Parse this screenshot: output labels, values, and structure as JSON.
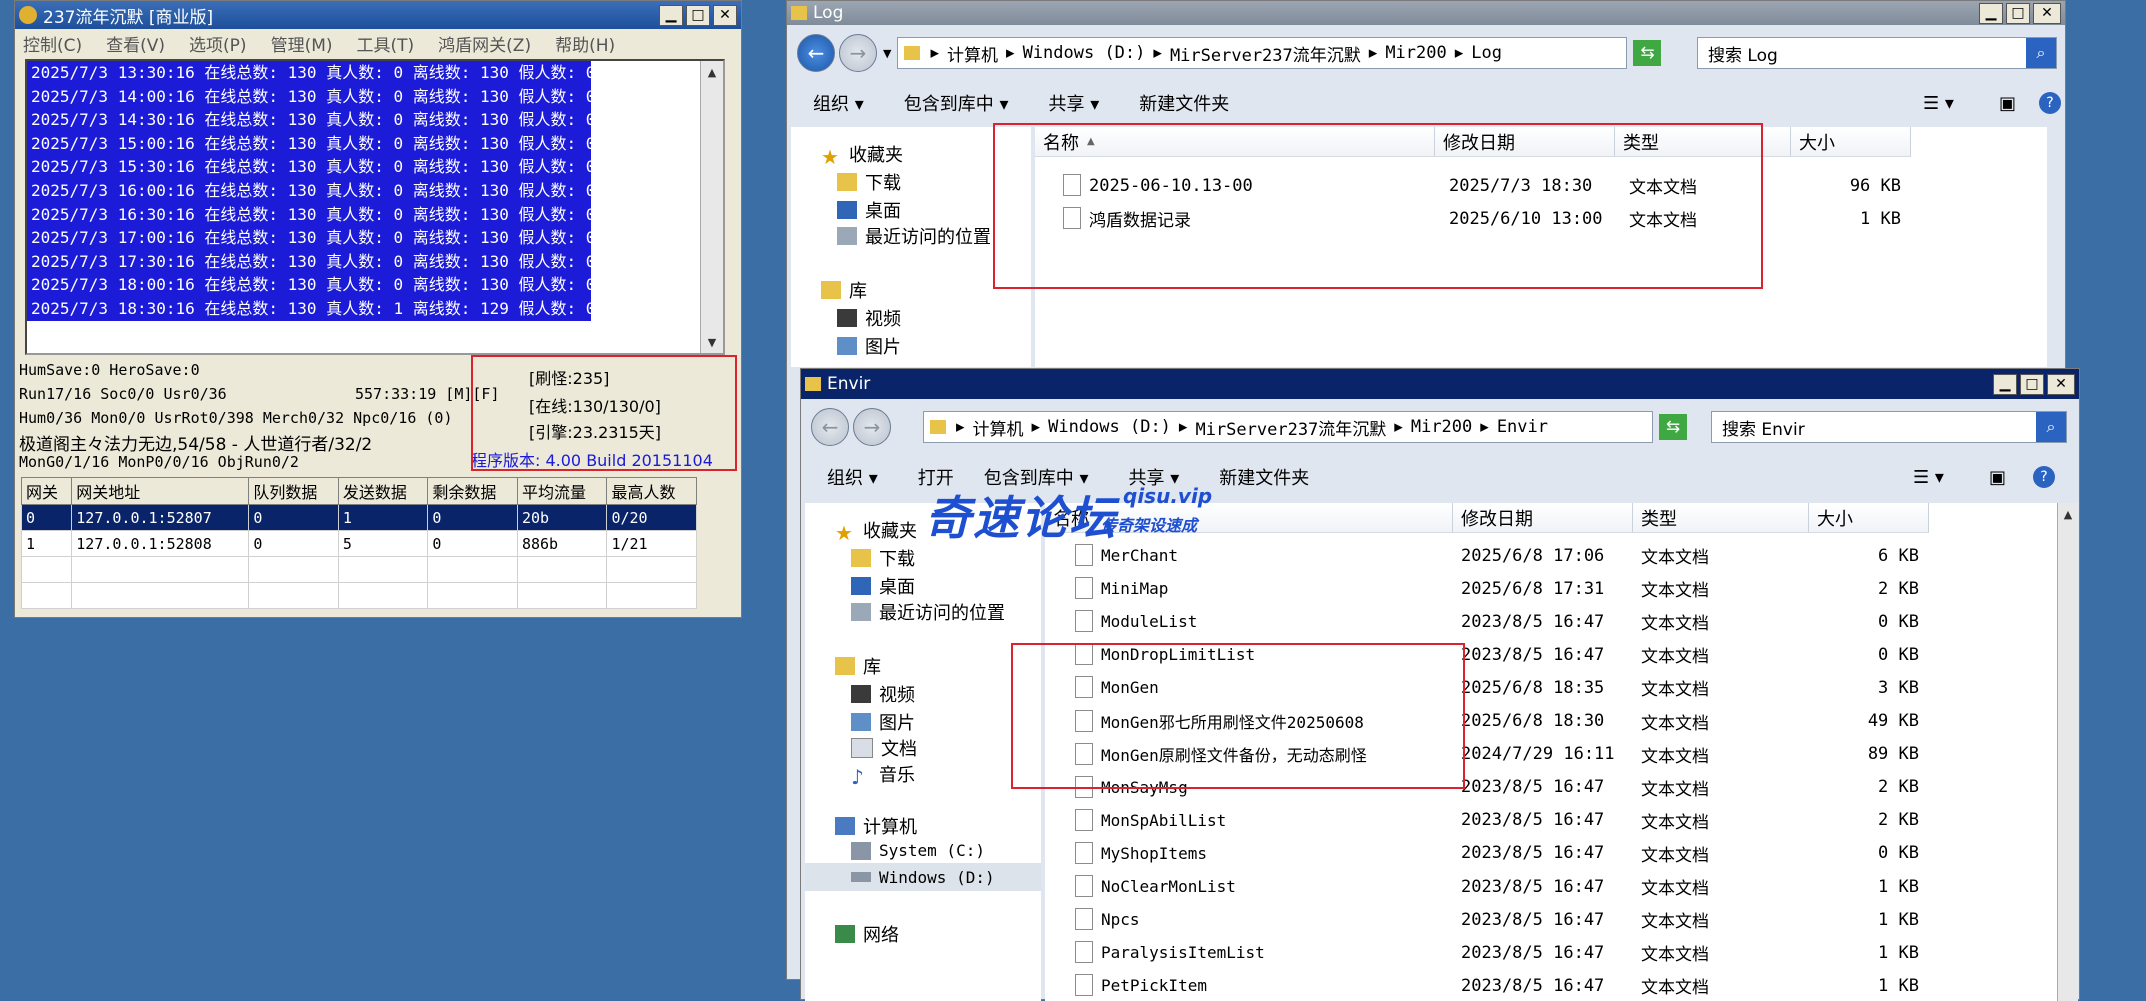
{
  "server": {
    "title": "237流年沉默 [商业版]",
    "menu": [
      "控制(C)",
      "查看(V)",
      "选项(P)",
      "管理(M)",
      "工具(T)",
      "鸿盾网关(Z)",
      "帮助(H)"
    ],
    "log_lines": [
      "2025/7/3 13:30:16 在线总数: 130 真人数: 0 离线数: 130 假人数: 0",
      "2025/7/3 14:00:16 在线总数: 130 真人数: 0 离线数: 130 假人数: 0",
      "2025/7/3 14:30:16 在线总数: 130 真人数: 0 离线数: 130 假人数: 0",
      "2025/7/3 15:00:16 在线总数: 130 真人数: 0 离线数: 130 假人数: 0",
      "2025/7/3 15:30:16 在线总数: 130 真人数: 0 离线数: 130 假人数: 0",
      "2025/7/3 16:00:16 在线总数: 130 真人数: 0 离线数: 130 假人数: 0",
      "2025/7/3 16:30:16 在线总数: 130 真人数: 0 离线数: 130 假人数: 0",
      "2025/7/3 17:00:16 在线总数: 130 真人数: 0 离线数: 130 假人数: 0",
      "2025/7/3 17:30:16 在线总数: 130 真人数: 0 离线数: 130 假人数: 0",
      "2025/7/3 18:00:16 在线总数: 130 真人数: 0 离线数: 130 假人数: 0",
      "2025/7/3 18:30:16 在线总数: 130 真人数: 1 离线数: 129 假人数: 0"
    ],
    "status": {
      "line1": "HumSave:0 HeroSave:0",
      "line2a": "Run17/16 Soc0/0 Usr0/36",
      "line2b": "557:33:19 [M][F]",
      "line3": "Hum0/36 Mon0/0 UsrRot0/398 Merch0/32 Npc0/16 (0)",
      "line4": "极道阁主々法力无边,54/58 - 人世道行者/32/2",
      "line5": "MonG0/1/16 MonP0/0/16 ObjRun0/2",
      "refresh": "[刷怪:235]",
      "online": "[在线:130/130/0]",
      "engine": "[引擎:23.2315天]",
      "version": "程序版本: 4.00 Build 20151104"
    },
    "gateway_headers": [
      "网关",
      "网关地址",
      "队列数据",
      "发送数据",
      "剩余数据",
      "平均流量",
      "最高人数"
    ],
    "gateway_rows": [
      [
        "0",
        "127.0.0.1:52807",
        "0",
        "1",
        "0",
        "20b",
        "0/20"
      ],
      [
        "1",
        "127.0.0.1:52808",
        "0",
        "5",
        "0",
        "886b",
        "1/21"
      ]
    ]
  },
  "log_explorer": {
    "title": "Log",
    "crumbs": [
      "计算机",
      "Windows (D:)",
      "MirServer237流年沉默",
      "Mir200",
      "Log"
    ],
    "search_placeholder": "搜索 Log",
    "toolbar": [
      "组织 ▾",
      "包含到库中 ▾",
      "共享 ▾",
      "新建文件夹"
    ],
    "nav": [
      "收藏夹",
      "下载",
      "桌面",
      "最近访问的位置",
      "库",
      "视频",
      "图片"
    ],
    "columns": [
      "名称",
      "修改日期",
      "类型",
      "大小"
    ],
    "files": [
      {
        "name": "2025-06-10.13-00",
        "date": "2025/7/3 18:30",
        "type": "文本文档",
        "size": "96 KB"
      },
      {
        "name": "鸿盾数据记录",
        "date": "2025/6/10 13:00",
        "type": "文本文档",
        "size": "1 KB"
      }
    ]
  },
  "envir_explorer": {
    "title": "Envir",
    "crumbs": [
      "计算机",
      "Windows (D:)",
      "MirServer237流年沉默",
      "Mir200",
      "Envir"
    ],
    "search_placeholder": "搜索 Envir",
    "toolbar": [
      "组织 ▾",
      "打开",
      "包含到库中 ▾",
      "共享 ▾",
      "新建文件夹"
    ],
    "nav": [
      "收藏夹",
      "下载",
      "桌面",
      "最近访问的位置",
      "库",
      "视频",
      "图片",
      "文档",
      "音乐",
      "计算机",
      "System (C:)",
      "Windows (D:)",
      "网络"
    ],
    "columns": [
      "名称",
      "修改日期",
      "类型",
      "大小"
    ],
    "files": [
      {
        "name": "MerChant",
        "date": "2025/6/8 17:06",
        "type": "文本文档",
        "size": "6 KB"
      },
      {
        "name": "MiniMap",
        "date": "2025/6/8 17:31",
        "type": "文本文档",
        "size": "2 KB"
      },
      {
        "name": "ModuleList",
        "date": "2023/8/5 16:47",
        "type": "文本文档",
        "size": "0 KB"
      },
      {
        "name": "MonDropLimitList",
        "date": "2023/8/5 16:47",
        "type": "文本文档",
        "size": "0 KB"
      },
      {
        "name": "MonGen",
        "date": "2025/6/8 18:35",
        "type": "文本文档",
        "size": "3 KB"
      },
      {
        "name": "MonGen邪七所用刷怪文件20250608",
        "date": "2025/6/8 18:30",
        "type": "文本文档",
        "size": "49 KB"
      },
      {
        "name": "MonGen原刷怪文件备份，无动态刷怪",
        "date": "2024/7/29 16:11",
        "type": "文本文档",
        "size": "89 KB"
      },
      {
        "name": "MonSayMsg",
        "date": "2023/8/5 16:47",
        "type": "文本文档",
        "size": "2 KB"
      },
      {
        "name": "MonSpAbilList",
        "date": "2023/8/5 16:47",
        "type": "文本文档",
        "size": "2 KB"
      },
      {
        "name": "MyShopItems",
        "date": "2023/8/5 16:47",
        "type": "文本文档",
        "size": "0 KB"
      },
      {
        "name": "NoClearMonList",
        "date": "2023/8/5 16:47",
        "type": "文本文档",
        "size": "1 KB"
      },
      {
        "name": "Npcs",
        "date": "2023/8/5 16:47",
        "type": "文本文档",
        "size": "1 KB"
      },
      {
        "name": "ParalysisItemList",
        "date": "2023/8/5 16:47",
        "type": "文本文档",
        "size": "1 KB"
      },
      {
        "name": "PetPickItem",
        "date": "2023/8/5 16:47",
        "type": "文本文档",
        "size": "1 KB"
      }
    ]
  },
  "watermark": {
    "big": "奇速论坛",
    "small": "qisu.vip",
    "sub": "传奇架设速成"
  }
}
